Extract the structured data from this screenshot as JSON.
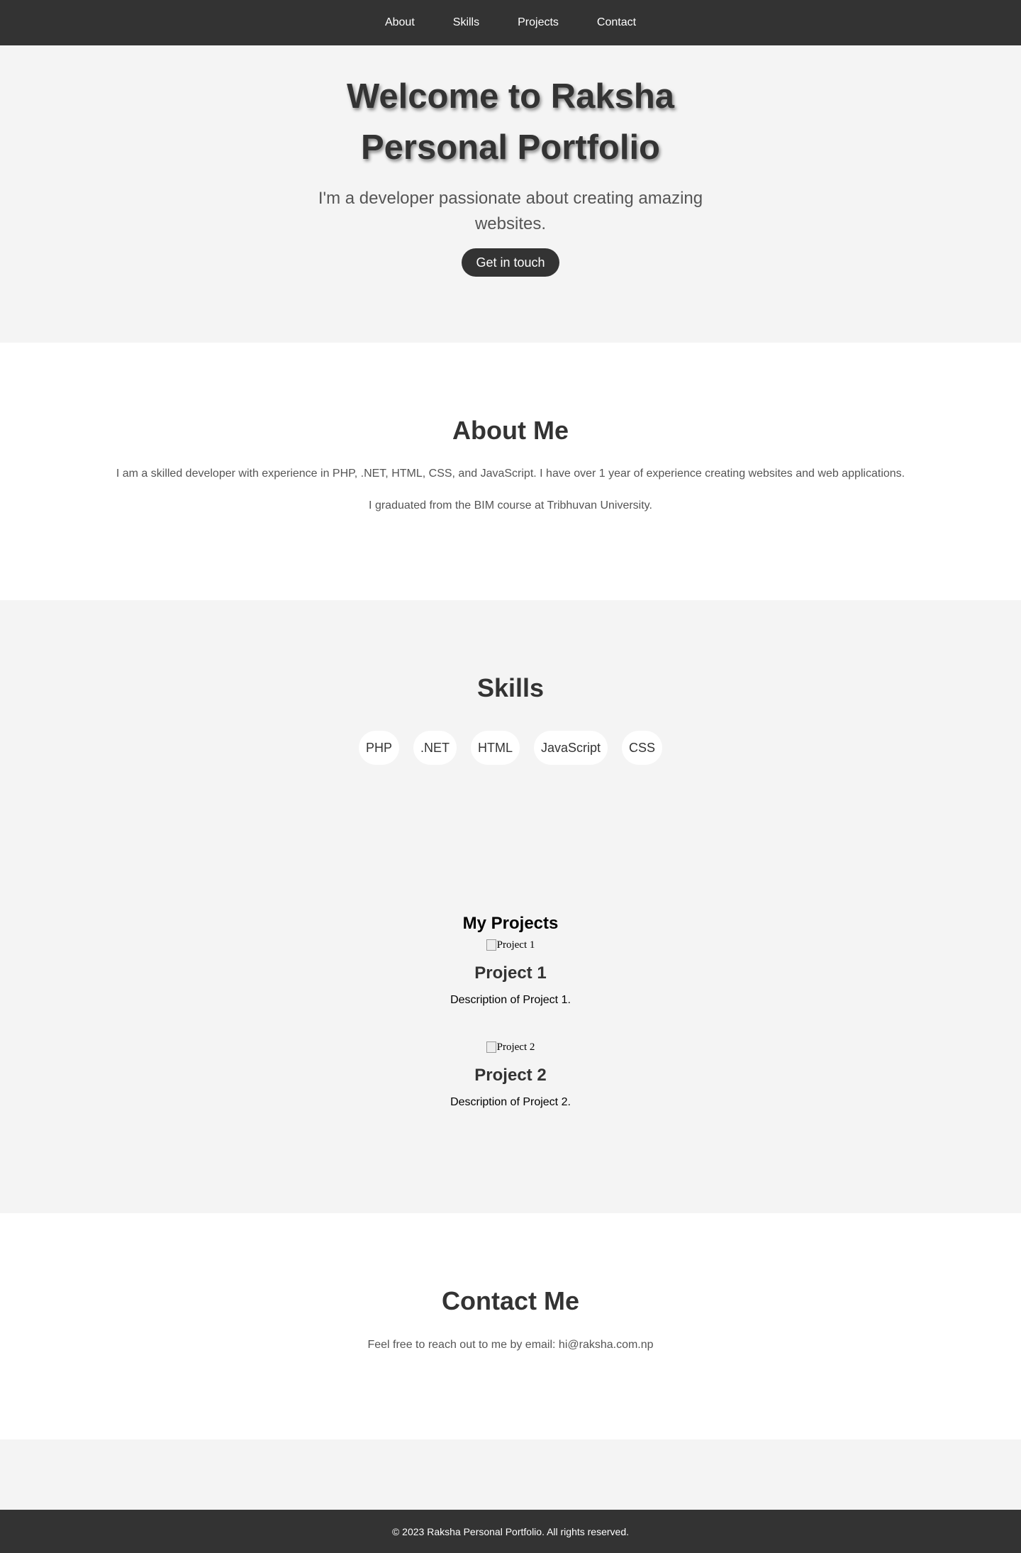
{
  "nav": {
    "items": [
      {
        "label": "About"
      },
      {
        "label": "Skills"
      },
      {
        "label": "Projects"
      },
      {
        "label": "Contact"
      }
    ]
  },
  "hero": {
    "title": "Welcome to Raksha Personal Portfolio",
    "subtitle": "I'm a developer passionate about creating amazing websites.",
    "cta_label": "Get in touch"
  },
  "about": {
    "heading": "About Me",
    "paragraph1": "I am a skilled developer with experience in PHP, .NET, HTML, CSS, and JavaScript. I have over 1 year of experience creating websites and web applications.",
    "paragraph2": "I graduated from the BIM course at Tribhuvan University."
  },
  "skills": {
    "heading": "Skills",
    "items": [
      "PHP",
      ".NET",
      "HTML",
      "JavaScript",
      "CSS"
    ]
  },
  "projects": {
    "heading": "My Projects",
    "items": [
      {
        "image_alt": "Project 1",
        "title": "Project 1",
        "description": "Description of Project 1."
      },
      {
        "image_alt": "Project 2",
        "title": "Project 2",
        "description": "Description of Project 2."
      }
    ]
  },
  "contact": {
    "heading": "Contact Me",
    "text": "Feel free to reach out to me by email: hi@raksha.com.np"
  },
  "footer": {
    "text": "© 2023 Raksha Personal Portfolio. All rights reserved."
  },
  "colors": {
    "dark": "#333333",
    "light_bg": "#f4f4f4",
    "white": "#ffffff",
    "muted_text": "#555555"
  }
}
